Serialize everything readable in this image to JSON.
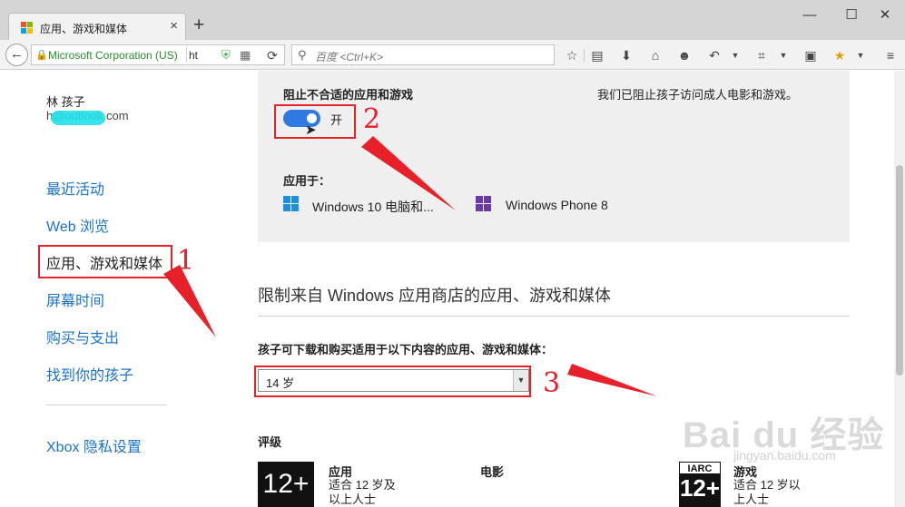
{
  "browser": {
    "tab_title": "应用、游戏和媒体",
    "tab_close": "×",
    "new_tab": "+",
    "window_controls": {
      "minimize": "—",
      "maximize": "☐",
      "close": "✕"
    },
    "identity": "Microsoft Corporation (US)",
    "url_text": "ht",
    "search_placeholder": "百度 <Ctrl+K>",
    "icons": [
      "bookmark-star-icon",
      "reading-list-icon",
      "download-icon",
      "home-icon",
      "chat-icon",
      "undo-icon",
      "crop-icon",
      "text-icon",
      "star-extension-icon",
      "menu-icon"
    ]
  },
  "sidebar": {
    "user_name": "林 孩子",
    "user_email": "h@outlook.com",
    "items": [
      {
        "label": "最近活动"
      },
      {
        "label": "Web 浏览"
      },
      {
        "label": "应用、游戏和媒体"
      },
      {
        "label": "屏幕时间"
      },
      {
        "label": "购买与支出"
      },
      {
        "label": "找到你的孩子"
      }
    ],
    "xbox_link": "Xbox 隐私设置"
  },
  "block_panel": {
    "title": "阻止不合适的应用和游戏",
    "description": "我们已阻止孩子访问成人电影和游戏。",
    "toggle_state": "开",
    "applies_to_label": "应用于：",
    "devices": [
      {
        "label": "Windows 10 电脑和...",
        "logo_color": "#1e8fe0"
      },
      {
        "label": "Windows Phone 8",
        "logo_color": "#6a3aa8"
      }
    ]
  },
  "restrictions": {
    "heading": "限制来自 Windows 应用商店的应用、游戏和媒体",
    "age_label": "孩子可下载和购买适用于以下内容的应用、游戏和媒体：",
    "age_value": "14 岁",
    "ratings_label": "评级",
    "rating_badge": "12+",
    "categories": [
      {
        "title": "应用",
        "desc1": "适合 12 岁及",
        "desc2": "以上人士"
      },
      {
        "title": "电影",
        "desc1": "",
        "desc2": ""
      },
      {
        "title": "游戏",
        "desc1": "适合 12 岁以",
        "desc2": "上人士"
      }
    ],
    "iarc_top": "IARC",
    "iarc_num": "12+"
  },
  "annotations": {
    "numbers": [
      "1",
      "2",
      "3"
    ],
    "color": "#e8202a"
  },
  "watermark": {
    "text": "Bai du 经验",
    "sub": "jingyan.baidu.com"
  }
}
